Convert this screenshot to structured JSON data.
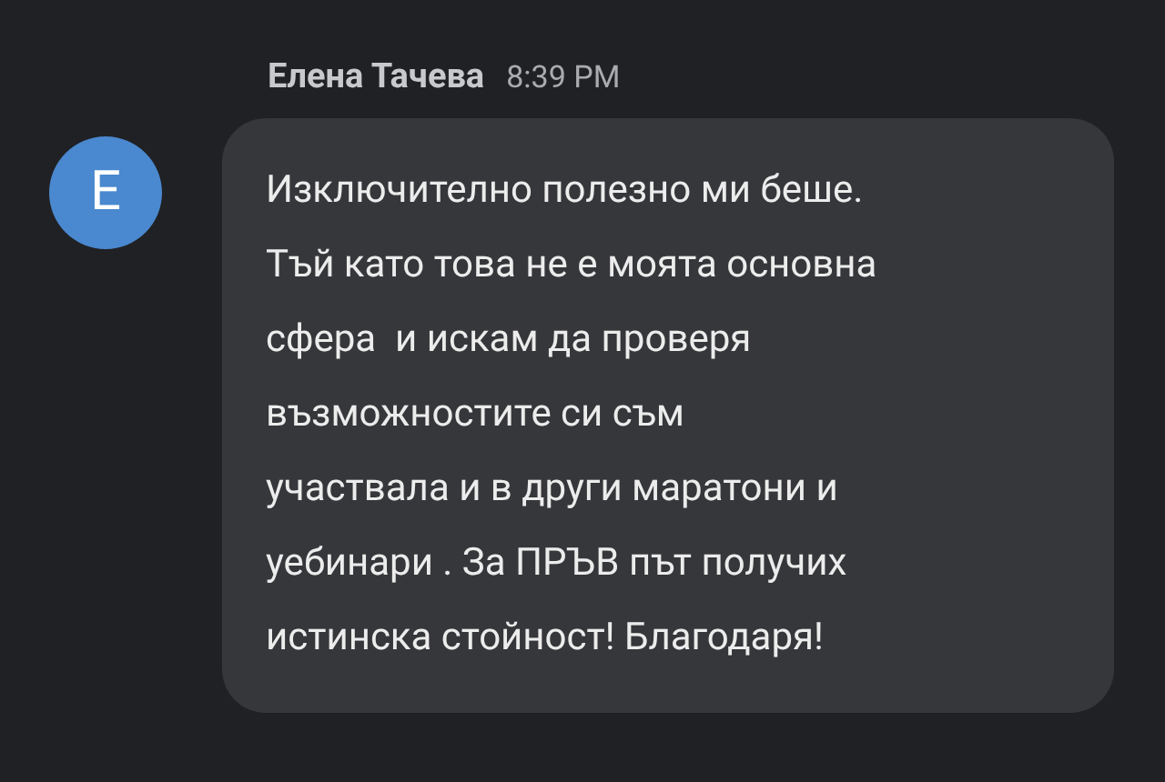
{
  "message": {
    "sender": "Елена Тачева",
    "time": "8:39 PM",
    "avatar_letter": "Е",
    "text": "Изключително полезно ми беше.\nТъй като това не е моята основна\nсфера  и искам да проверя\nвъзможностите си съм\nучаствала и в други маратони и\nуебинари . За ПРЪВ път получих\nистинска стойност! Благодаря!"
  }
}
